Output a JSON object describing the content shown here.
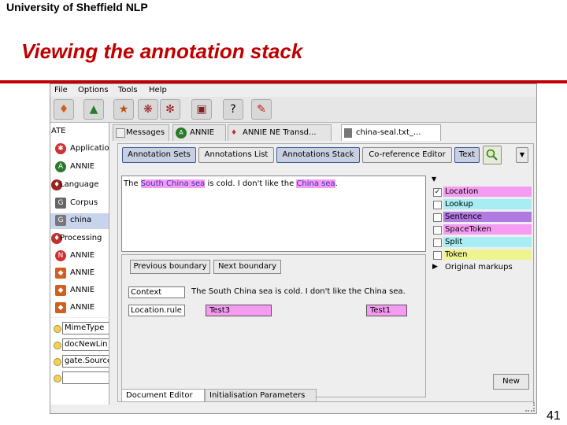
{
  "slide": {
    "header": "University of Sheffield NLP",
    "title": "Viewing the annotation stack",
    "page_number": "41"
  },
  "app": {
    "menu": [
      "File",
      "Options",
      "Tools",
      "Help"
    ],
    "toolbar_icons": [
      "new-application-icon",
      "annie-icon",
      "load-resource-icon",
      "plugin-icon",
      "gear-icon",
      "datastore-icon",
      "help-icon",
      "edit-icon"
    ],
    "tree": [
      {
        "label": "ATE",
        "icon": "gate-icon"
      },
      {
        "label": "Application",
        "icon": "application-icon"
      },
      {
        "label": "ANNIE",
        "icon": "annie-icon"
      },
      {
        "label": "Language",
        "icon": "language-resource-icon"
      },
      {
        "label": "Corpus",
        "icon": "corpus-icon"
      },
      {
        "label": "china",
        "icon": "document-icon"
      },
      {
        "label": "Processing",
        "icon": "processing-icon"
      },
      {
        "label": "ANNIE",
        "icon": "ne-icon"
      },
      {
        "label": "ANNIE",
        "icon": "pr-icon"
      },
      {
        "label": "ANNIE",
        "icon": "pr-icon"
      },
      {
        "label": "ANNIE",
        "icon": "pr-icon"
      }
    ],
    "features": [
      "MimeType",
      "docNewLin",
      "gate.Source",
      ""
    ],
    "doc_tabs": [
      {
        "label": "Messages",
        "icon": "messages-icon"
      },
      {
        "label": "ANNIE",
        "icon": "annie-icon"
      },
      {
        "label": "ANNIE NE Transd...",
        "icon": "ne-icon"
      },
      {
        "label": "china-seal.txt_...",
        "icon": "document-icon"
      }
    ],
    "view_buttons": [
      "Annotation Sets",
      "Annotations List",
      "Annotations Stack",
      "Co-reference Editor",
      "Text"
    ],
    "text_segments": [
      {
        "t": "The ",
        "hl": false
      },
      {
        "t": "South China sea",
        "hl": true
      },
      {
        "t": " is cold. I don't like the ",
        "hl": false
      },
      {
        "t": "China sea",
        "hl": true
      },
      {
        "t": ".",
        "hl": false
      }
    ],
    "annotation_sets": [
      {
        "label": "Location",
        "checked": true,
        "color": "#f59cf2"
      },
      {
        "label": "Lookup",
        "checked": false,
        "color": "#a6eef3"
      },
      {
        "label": "Sentence",
        "checked": false,
        "color": "#b07ae0"
      },
      {
        "label": "SpaceToken",
        "checked": false,
        "color": "#f59cf2"
      },
      {
        "label": "Split",
        "checked": false,
        "color": "#a6eef3"
      },
      {
        "label": "Token",
        "checked": false,
        "color": "#eef590"
      }
    ],
    "original_markups": "Original markups",
    "stack": {
      "prev": "Previous boundary",
      "next": "Next boundary",
      "context_label": "Context",
      "context_text": "The South China sea is cold. I don't like the China sea.",
      "row_label": "Location.rule",
      "boxes": [
        "Test3",
        "Test1"
      ]
    },
    "new_button": "New",
    "bottom_tabs": [
      "Document Editor",
      "Initialisation Parameters"
    ]
  }
}
